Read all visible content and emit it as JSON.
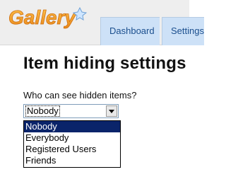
{
  "header": {
    "logo_text": "Gallery",
    "tabs": [
      {
        "label": "Dashboard"
      },
      {
        "label": "Settings"
      }
    ]
  },
  "main": {
    "title": "Item hiding settings",
    "field_label": "Who can see hidden items?",
    "select": {
      "value": "Nobody",
      "options": [
        "Nobody",
        "Everybody",
        "Registered Users",
        "Friends"
      ],
      "selected_index": 0
    }
  },
  "colors": {
    "logo_orange": "#f39a1f",
    "tab_background": "#cde1f7",
    "tab_text": "#1b4f8e",
    "selected_option": "#0a246a"
  },
  "icons": {
    "logo": "gallery-logo",
    "dropdown_arrow": "chevron-down-icon"
  }
}
